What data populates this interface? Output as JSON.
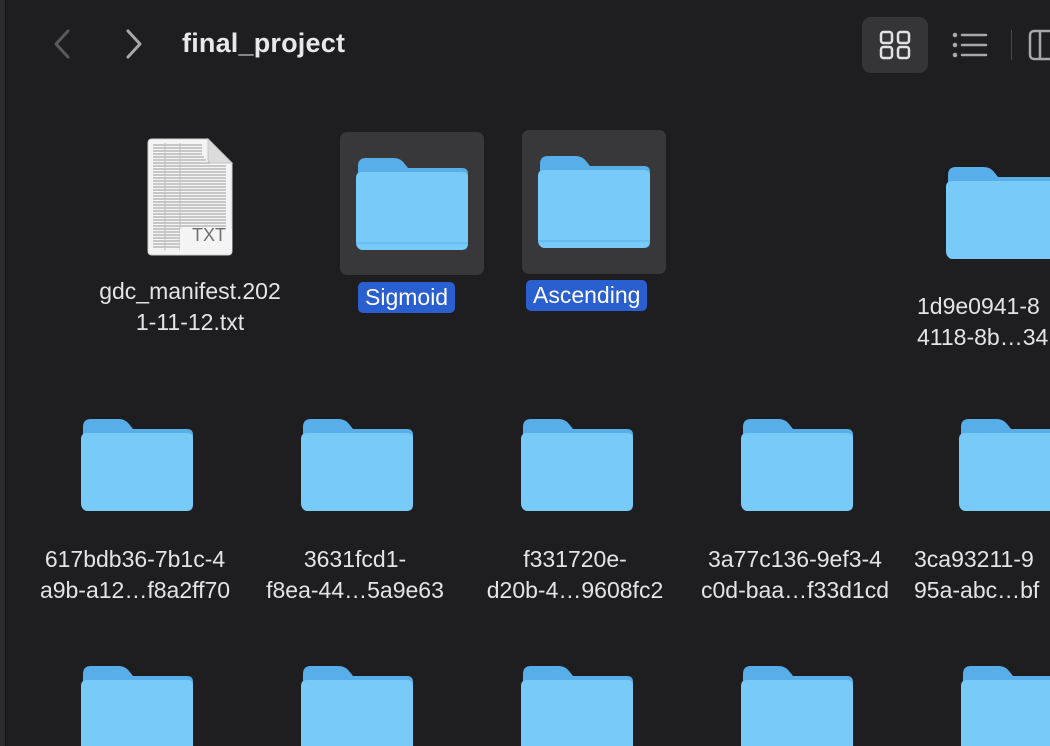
{
  "window": {
    "title": "final_project"
  },
  "toolbar": {
    "back_icon": "chevron-left-icon",
    "forward_icon": "chevron-right-icon",
    "icon_view_icon": "grid-icon",
    "list_view_icon": "list-icon",
    "column_view_icon": "columns-icon"
  },
  "colors": {
    "folder_top": "#6cc1f4",
    "folder_front": "#78cbf8",
    "selection_bg": "#38383b",
    "selection_label": "#2a5fd0"
  },
  "items": [
    {
      "name_line1": "gdc_manifest.202",
      "name_line2": "1-11-12.txt",
      "badge": "TXT",
      "type": "txt-file"
    },
    {
      "name": "Sigmoid",
      "type": "folder",
      "selected": true
    },
    {
      "name": "Ascending",
      "type": "folder",
      "selected": true
    },
    {
      "name_line1": "1d9e0941-8",
      "name_line2": "4118-8b…34",
      "type": "folder"
    },
    {
      "name_line1": "617bdb36-7b1c-4",
      "name_line2": "a9b-a12…f8a2ff70",
      "type": "folder"
    },
    {
      "name_line1": "3631fcd1-",
      "name_line2": "f8ea-44…5a9e63",
      "type": "folder"
    },
    {
      "name_line1": "f331720e-",
      "name_line2": "d20b-4…9608fc2",
      "type": "folder"
    },
    {
      "name_line1": "3a77c136-9ef3-4",
      "name_line2": "c0d-baa…f33d1cd",
      "type": "folder"
    },
    {
      "name_line1": "3ca93211-9",
      "name_line2": "95a-abc…bf",
      "type": "folder"
    }
  ]
}
